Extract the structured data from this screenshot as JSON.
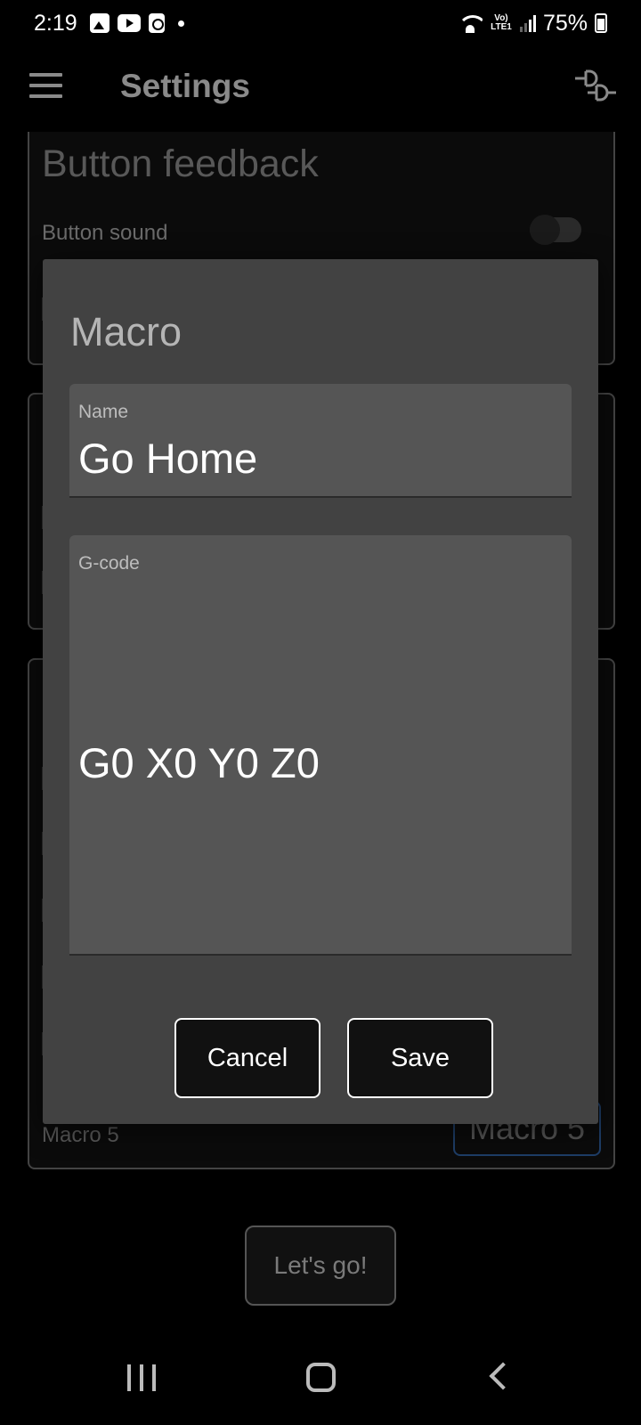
{
  "status_bar": {
    "time": "2:19",
    "battery": "75%",
    "network": "Vo) LTE1"
  },
  "app_bar": {
    "title": "Settings"
  },
  "background": {
    "section_title": "Button feedback",
    "button_sound_label": "Button sound",
    "macro5_label": "Macro 5",
    "macro5_button": "Macro 5",
    "lets_go_button": "Let's go!"
  },
  "dialog": {
    "title": "Macro",
    "name_label": "Name",
    "name_value": "Go Home",
    "gcode_label": "G-code",
    "gcode_value": "G0 X0 Y0 Z0",
    "cancel_label": "Cancel",
    "save_label": "Save"
  },
  "colors": {
    "background": "#000000",
    "dialog": "#424242",
    "field": "#555555",
    "accent_outline": "#1e3d66"
  }
}
